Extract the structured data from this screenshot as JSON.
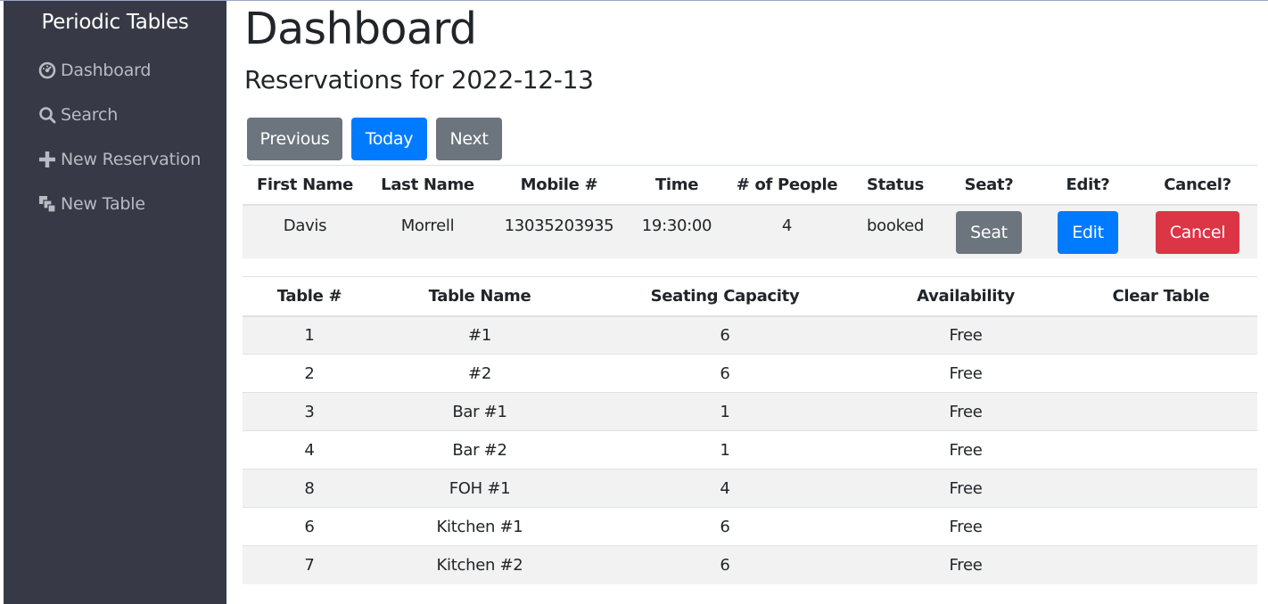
{
  "sidebar": {
    "brand": "Periodic Tables",
    "items": [
      {
        "label": "Dashboard",
        "icon": "dashboard-icon"
      },
      {
        "label": "Search",
        "icon": "search-icon"
      },
      {
        "label": "New Reservation",
        "icon": "plus-icon"
      },
      {
        "label": "New Table",
        "icon": "layers-icon"
      }
    ]
  },
  "main": {
    "title": "Dashboard",
    "subtitle": "Reservations for 2022-12-13",
    "nav_buttons": {
      "previous": "Previous",
      "today": "Today",
      "next": "Next"
    }
  },
  "reservations": {
    "headers": [
      "First Name",
      "Last Name",
      "Mobile #",
      "Time",
      "# of People",
      "Status",
      "Seat?",
      "Edit?",
      "Cancel?"
    ],
    "rows": [
      {
        "first_name": "Davis",
        "last_name": "Morrell",
        "mobile": "13035203935",
        "time": "19:30:00",
        "people": "4",
        "status": "booked",
        "seat_label": "Seat",
        "edit_label": "Edit",
        "cancel_label": "Cancel"
      }
    ]
  },
  "tables": {
    "headers": [
      "Table #",
      "Table Name",
      "Seating Capacity",
      "Availability",
      "Clear Table"
    ],
    "rows": [
      {
        "id": "1",
        "name": "#1",
        "capacity": "6",
        "availability": "Free"
      },
      {
        "id": "2",
        "name": "#2",
        "capacity": "6",
        "availability": "Free"
      },
      {
        "id": "3",
        "name": "Bar #1",
        "capacity": "1",
        "availability": "Free"
      },
      {
        "id": "4",
        "name": "Bar #2",
        "capacity": "1",
        "availability": "Free"
      },
      {
        "id": "8",
        "name": "FOH #1",
        "capacity": "4",
        "availability": "Free"
      },
      {
        "id": "6",
        "name": "Kitchen #1",
        "capacity": "6",
        "availability": "Free"
      },
      {
        "id": "7",
        "name": "Kitchen #2",
        "capacity": "6",
        "availability": "Free"
      }
    ]
  },
  "colors": {
    "sidebar_bg": "#373a46",
    "primary": "#007bff",
    "secondary": "#6c757d",
    "danger": "#dc3545",
    "stripe": "#f2f2f2"
  }
}
